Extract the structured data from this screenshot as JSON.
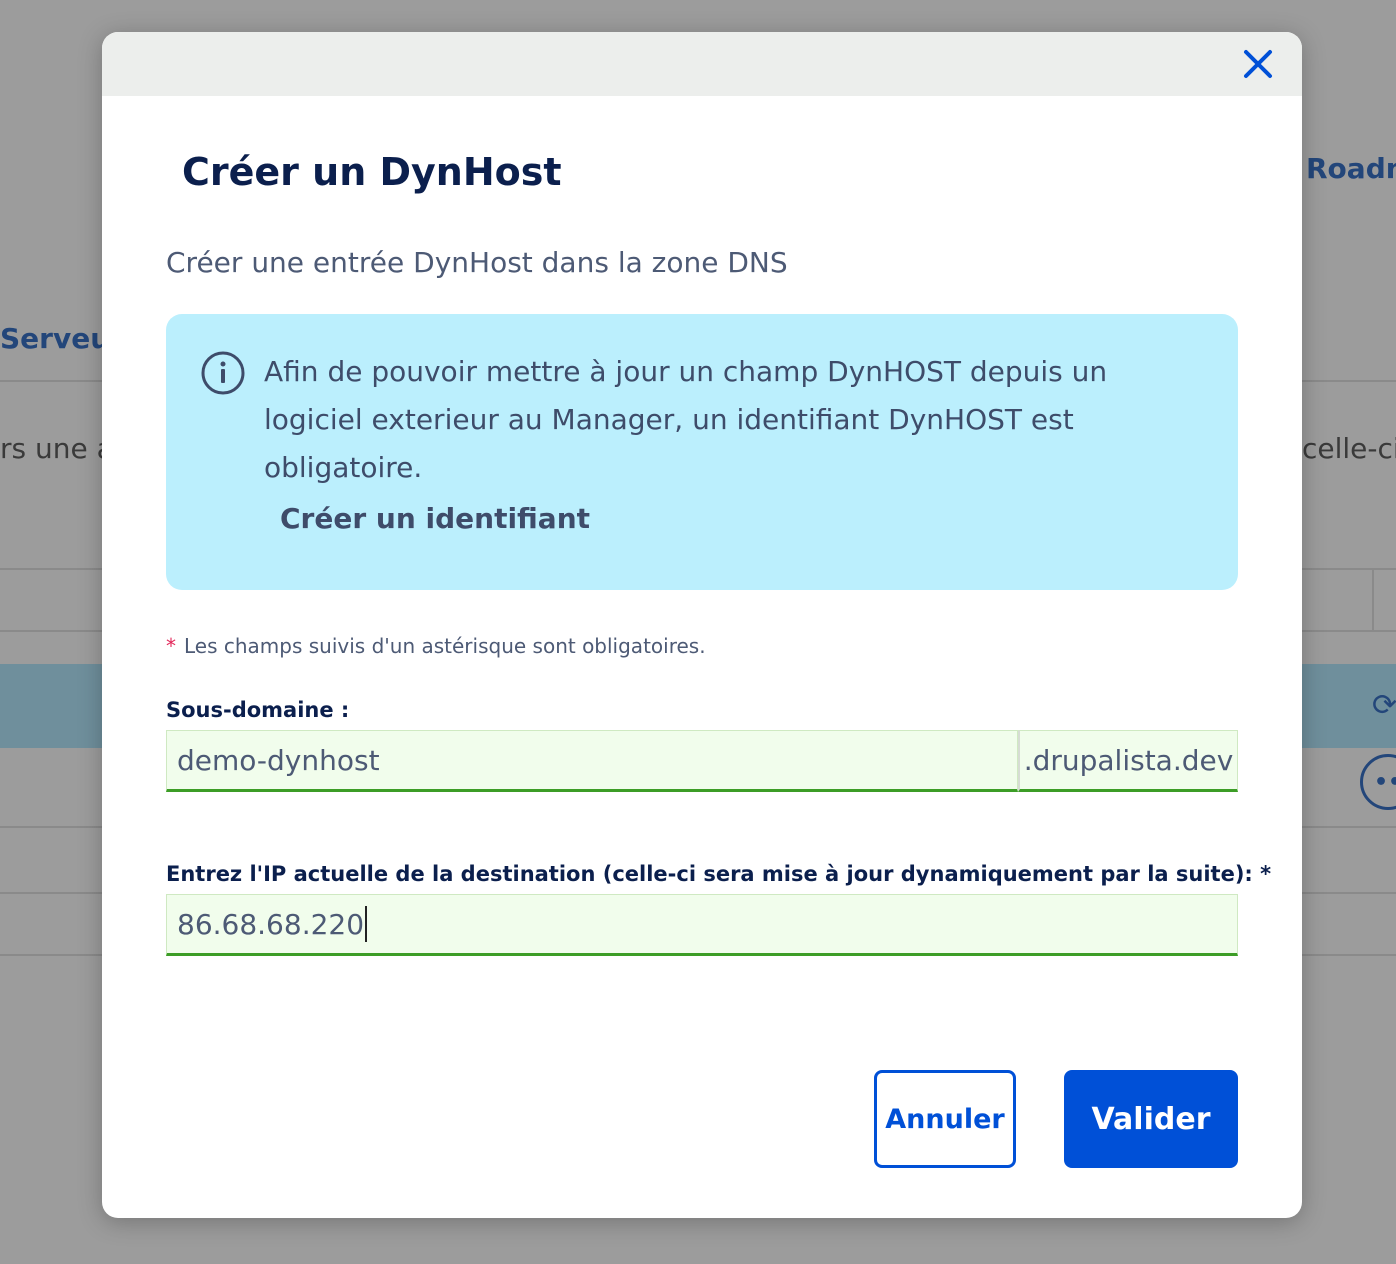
{
  "background": {
    "roadmap_link": "Roadm",
    "server_link": "Serveur",
    "text_left": "rs une a",
    "text_right": "celle-ci."
  },
  "modal": {
    "title": "Créer un DynHost",
    "description": "Créer une entrée DynHost dans la zone DNS",
    "info": {
      "icon": "info-icon",
      "message": "Afin de pouvoir mettre à jour un champ DynHOST depuis un logiciel exterieur au Manager, un identifiant DynHOST est obligatoire.",
      "link": "Créer un identifiant"
    },
    "required_note": {
      "asterisk": "*",
      "text": "Les champs suivis d'un astérisque sont obligatoires."
    },
    "subdomain": {
      "label": "Sous-domaine :",
      "value": "demo-dynhost",
      "suffix": ".drupalista.dev"
    },
    "ip": {
      "label": "Entrez l'IP actuelle de la destination (celle-ci sera mise à jour dynamiquement par la suite):  *",
      "value": "86.68.68.220"
    },
    "buttons": {
      "cancel": "Annuler",
      "submit": "Valider"
    },
    "colors": {
      "primary": "#0050d7",
      "info_bg": "#bbeffd",
      "title": "#0b1f4d",
      "valid_border": "#3c9d26"
    }
  }
}
